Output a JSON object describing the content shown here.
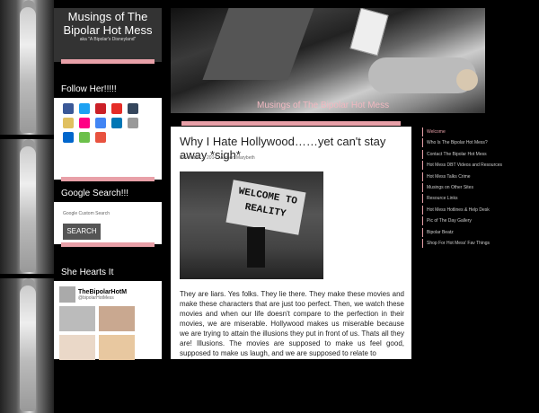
{
  "site": {
    "title": "Musings of The Bipolar Hot Mess",
    "subtitle": "aka \"A Bipolar's Disneyland\"",
    "header_caption": "Musings of The Bipolar Hot Mess"
  },
  "sidebar": {
    "follow": {
      "title": "Follow Her!!!!!",
      "icons": [
        {
          "name": "facebook-icon",
          "color": "#3b5998"
        },
        {
          "name": "twitter-icon",
          "color": "#1da1f2"
        },
        {
          "name": "pinterest-icon",
          "color": "#cb2027"
        },
        {
          "name": "youtube-icon",
          "color": "#e52d27"
        },
        {
          "name": "tumblr-icon",
          "color": "#35465c"
        },
        {
          "name": "delicious-icon",
          "color": "#e0c060"
        },
        {
          "name": "flickr-icon",
          "color": "#ff0084"
        },
        {
          "name": "google-icon",
          "color": "#4285f4"
        },
        {
          "name": "linkedin-icon",
          "color": "#0077b5"
        },
        {
          "name": "reddit-icon",
          "color": "#999999"
        },
        {
          "name": "delicious2-icon",
          "color": "#0066cc"
        },
        {
          "name": "stumbleupon-icon",
          "color": "#6cc04a"
        },
        {
          "name": "email-icon",
          "color": "#e8523f"
        }
      ]
    },
    "search": {
      "title": "Google Search!!!",
      "label": "Google Custom Search",
      "button": "SEARCH"
    },
    "hearts": {
      "title": "She Hearts It",
      "user_name": "TheBipolarHotM",
      "user_handle": "@bipolarHotMess"
    }
  },
  "post": {
    "title": "Why I Hate Hollywood……yet can't stay away *sigh*",
    "meta": "November 3, 2014 · Author: Marybeth",
    "image_text": "WELCOME TO REALITY",
    "body": "They are liars.  Yes folks.  They lie there.  They make these movies and make these characters that are just too perfect.  Then, we watch these movies and when our life doesn't compare to the perfection in their movies, we are miserable.  Hollywood makes us miserable because we are trying to attain the illusions they put in front of us.  Thats all they are! Illusions.  The movies are supposed to make us feel good, supposed to make us laugh, and we are supposed to relate to"
  },
  "nav": [
    "Welcome",
    "Who Is The Bipolar Hot Mess?",
    "Contact The Bipolar Hot Mess",
    "Hot Mess DBT Videos and Resources",
    "Hot Mess Talks Crime",
    "Musings on Other Sites",
    "Resource Links",
    "Hot Mess Hotlines & Help Desk",
    "Pic of The Day Gallery",
    "Bipolar Beatz",
    "Shop For Hot Mess' Fav Things"
  ],
  "colors": {
    "accent": "#e8a0a8",
    "dark": "#333333"
  }
}
